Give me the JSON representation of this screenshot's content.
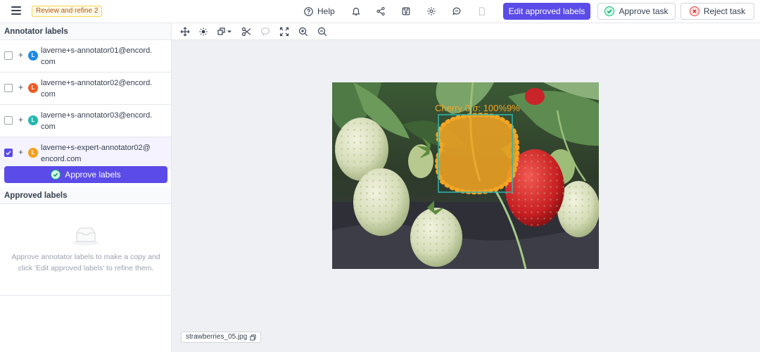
{
  "topbar": {
    "stage_badge": "Review and refine 2",
    "help_label": "Help",
    "edit_approved_label": "Edit approved labels",
    "approve_task_label": "Approve task",
    "reject_task_label": "Reject task"
  },
  "sidebar": {
    "annotator_title": "Annotator labels",
    "annotators": [
      {
        "email": "laverne+s-annotator01@encord.com",
        "initial": "L",
        "avatar_color": "#1d8ae6",
        "checked": false
      },
      {
        "email": "laverne+s-annotator02@encord.com",
        "initial": "L",
        "avatar_color": "#ef5a24",
        "checked": false
      },
      {
        "email": "laverne+s-annotator03@encord.com",
        "initial": "L",
        "avatar_color": "#22b8b0",
        "checked": false
      },
      {
        "email": "laverne+s-expert-annotator02@encord.com",
        "initial": "L",
        "avatar_color": "#f4a11b",
        "checked": true
      }
    ],
    "approve_labels_button": "Approve labels",
    "approved_title": "Approved labels",
    "empty_text": "Approve annotator labels to make a copy and click 'Edit approved labels' to refine them."
  },
  "canvas": {
    "annotation_label": "Cherry 0  σ: 100%9%",
    "filename": "strawberries_05.jpg",
    "annotation_color": "#f5a623",
    "bbox_color": "#2fb5b0"
  },
  "colors": {
    "accent": "#5b4be8",
    "approve": "#10b981",
    "reject": "#ef4444"
  }
}
